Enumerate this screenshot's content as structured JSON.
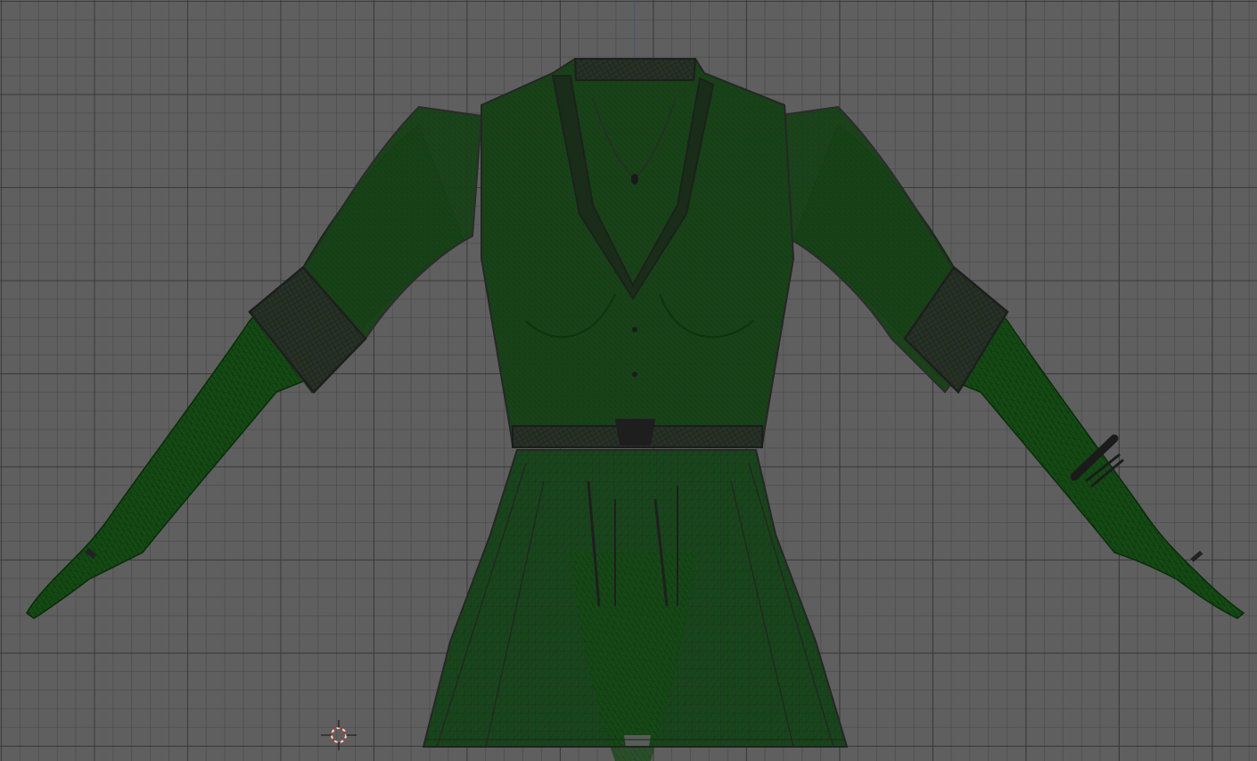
{
  "viewport": {
    "mode": "wireframe",
    "view": "front-orthographic",
    "background_color": "#5f5f5f",
    "grid_color": "#464646"
  },
  "model": {
    "body_wire_color": "#0f4a0f",
    "body_fill_color": "#154a15",
    "clothing_wire_color": "#2b2b2b",
    "accessory_color": "#1e1e1e"
  },
  "cursor": {
    "icon": "3d-cursor-icon",
    "outer_color": "#e0e0e0",
    "ring_color": "#d03030"
  }
}
